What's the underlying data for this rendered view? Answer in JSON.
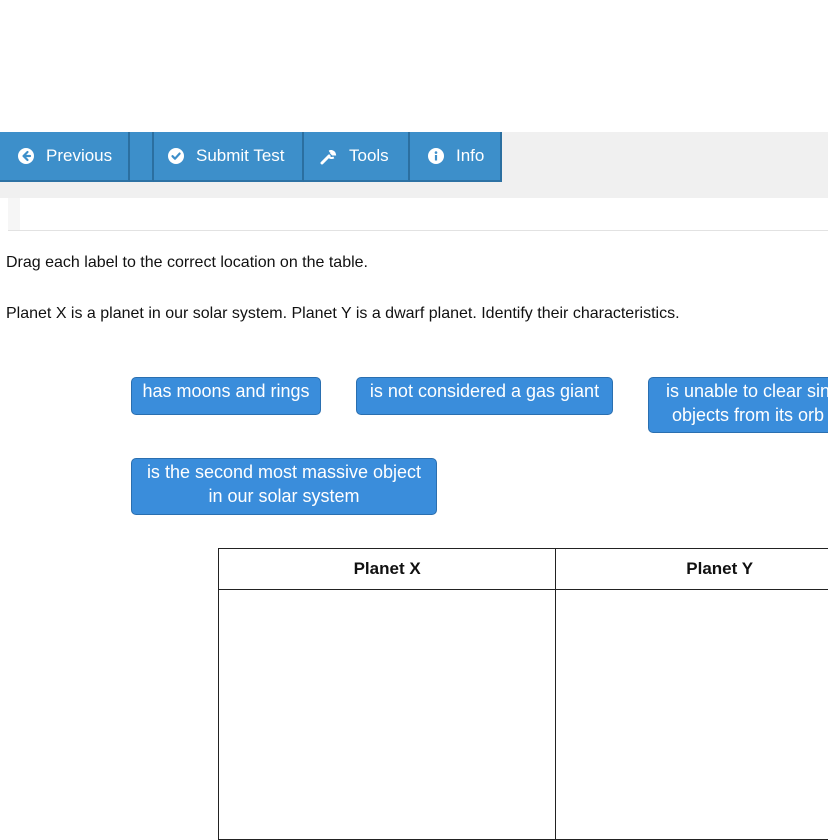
{
  "toolbar": {
    "previous_label": "Previous",
    "submit_label": "Submit Test",
    "tools_label": "Tools",
    "info_label": "Info",
    "color": "#3d8fca"
  },
  "content": {
    "instruction": "Drag each label to the correct location on the table.",
    "question": "Planet X is a planet in our solar system. Planet Y is a dwarf planet. Identify their characteristics."
  },
  "labels": [
    {
      "text": "has moons and rings"
    },
    {
      "text": "is not considered a gas giant"
    },
    {
      "text_line1": "is unable to clear sin",
      "text_line2": "objects from its orb"
    },
    {
      "text_line1": "is the second most massive object",
      "text_line2": "in our solar system"
    }
  ],
  "table": {
    "headers": [
      "Planet X",
      "Planet Y"
    ]
  },
  "icons": {
    "previous": "arrow-circle-left-icon",
    "submit": "check-circle-icon",
    "tools": "wrench-icon",
    "info": "info-circle-icon"
  }
}
